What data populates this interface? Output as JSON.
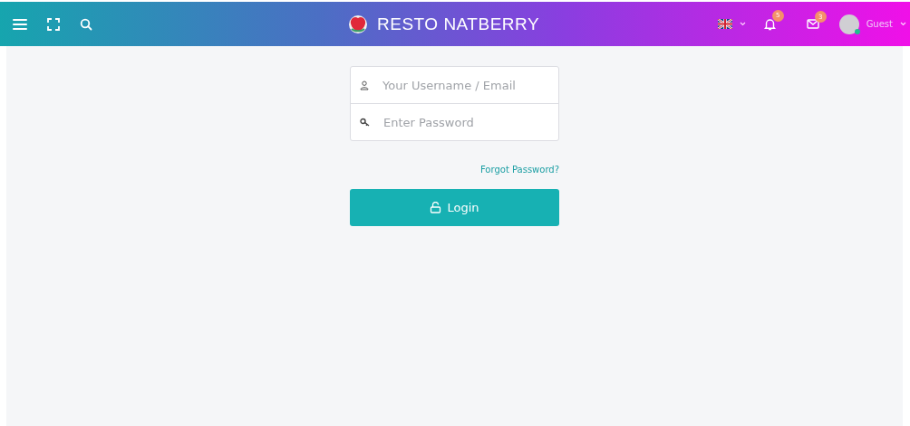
{
  "header": {
    "brand": "RESTO NATBERRY",
    "notifications": {
      "count": "5"
    },
    "messages": {
      "count": "3"
    },
    "user": {
      "name": "Guest",
      "online": true
    }
  },
  "login": {
    "username": {
      "placeholder": "Your Username / Email"
    },
    "password": {
      "placeholder": "Enter Password"
    },
    "forgot": "Forgot Password?",
    "button": "Login"
  }
}
